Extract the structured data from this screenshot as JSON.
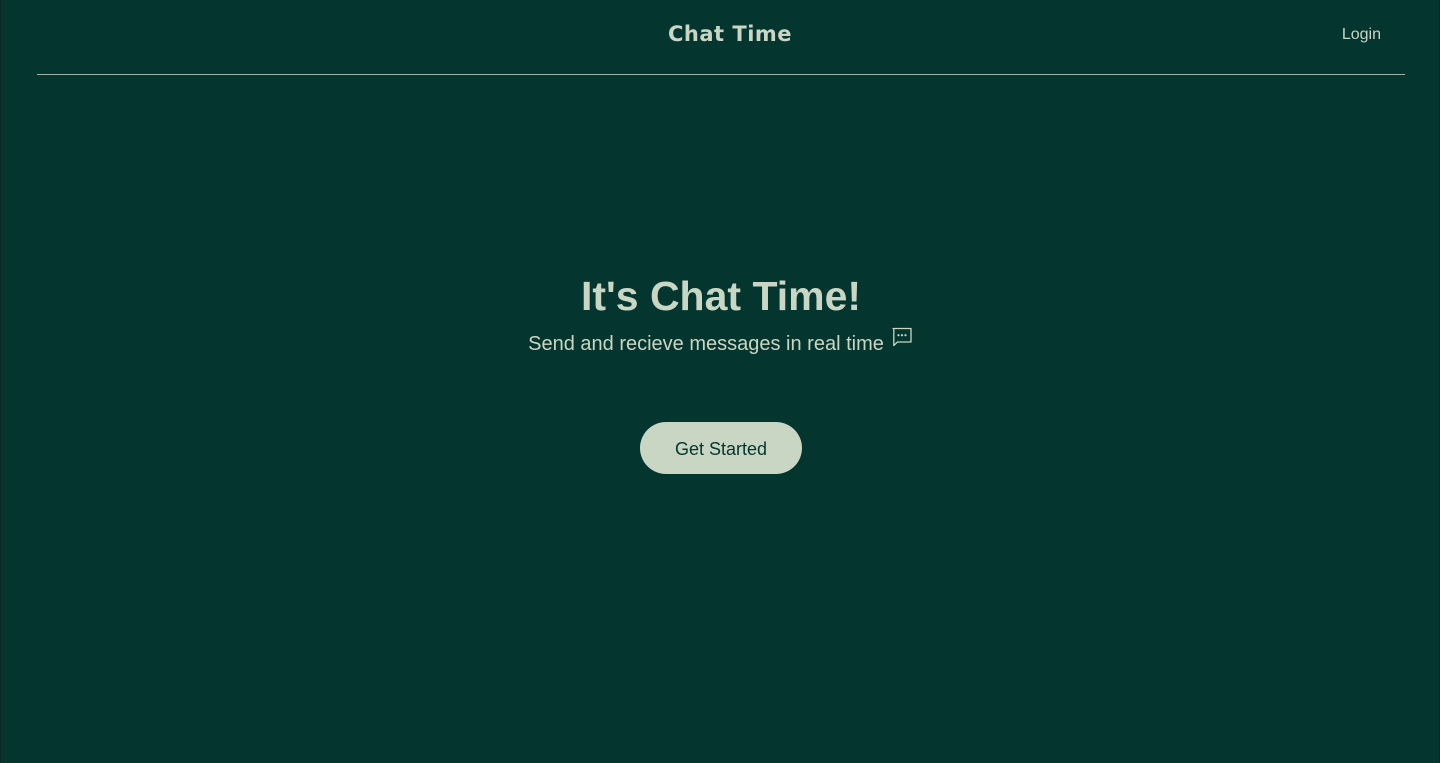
{
  "header": {
    "brand": "Chat Time",
    "login_label": "Login"
  },
  "hero": {
    "title": "It's Chat Time!",
    "subtitle": "Send and recieve messages in real time",
    "subtitle_icon": "chat-bubble-icon",
    "cta_label": "Get Started"
  },
  "colors": {
    "background": "#04352f",
    "foreground": "#c9d6c4",
    "divider": "#9fb3aa",
    "button_bg": "#c9d6c4",
    "button_text": "#04352f"
  }
}
